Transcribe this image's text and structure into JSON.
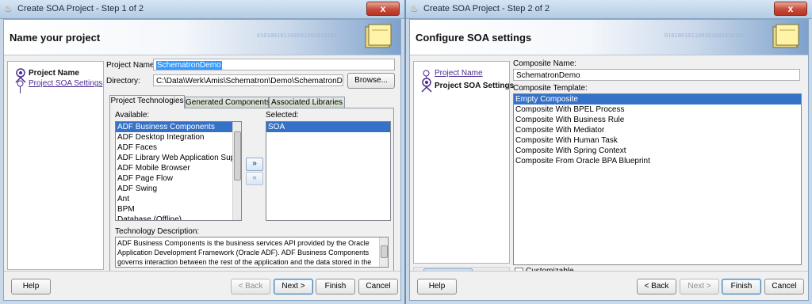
{
  "window1": {
    "title": "Create SOA Project - Step 1 of 2",
    "close_glyph": "x",
    "banner_title": "Name your project",
    "banner_digits": "010100101100101001010101",
    "nav": [
      {
        "label": "Project Name",
        "state": "current"
      },
      {
        "label": "Project SOA Settings",
        "state": "link"
      }
    ],
    "project_name_label": "Project Name:",
    "project_name_value": "SchematronDemo",
    "directory_label": "Directory:",
    "directory_value": "C:\\Data\\Werk\\Amis\\Schematron\\Demo\\SchematronDemo",
    "browse_label": "Browse...",
    "tabs": [
      "Project Technologies",
      "Generated Components",
      "Associated Libraries"
    ],
    "available_label": "Available:",
    "available_items": [
      "ADF Business Components",
      "ADF Desktop Integration",
      "ADF Faces",
      "ADF Library Web Application Support",
      "ADF Mobile Browser",
      "ADF Page Flow",
      "ADF Swing",
      "Ant",
      "BPM",
      "Database (Offline)"
    ],
    "available_selected": 0,
    "selected_label": "Selected:",
    "selected_items": [
      "SOA"
    ],
    "add_arrow": "»",
    "remove_arrow": "«",
    "desc_label": "Technology Description:",
    "desc_text": "ADF Business Components is the business services API provided by the Oracle Application Development Framework (Oracle ADF).  ADF Business Components governs interaction between the rest of the application and the data stored in the",
    "help_label": "Help",
    "back_label": "< Back",
    "next_label": "Next >",
    "finish_label": "Finish",
    "cancel_label": "Cancel"
  },
  "window2": {
    "title": "Create SOA Project - Step 2 of 2",
    "close_glyph": "x",
    "banner_title": "Configure SOA settings",
    "banner_digits": "010100101100101001010101",
    "nav": [
      {
        "label": "Project Name",
        "state": "link"
      },
      {
        "label": "Project SOA Settings",
        "state": "current"
      }
    ],
    "composite_name_label": "Composite Name:",
    "composite_name_value": "SchematronDemo",
    "composite_template_label": "Composite Template:",
    "templates": [
      "Empty Composite",
      "Composite With BPEL Process",
      "Composite With Business Rule",
      "Composite With Mediator",
      "Composite With Human Task",
      "Composite With Spring Context",
      "Composite From Oracle BPA Blueprint"
    ],
    "template_selected": 0,
    "customizable_label": "Customizable",
    "customizable_checked": false,
    "help_label": "Help",
    "back_label": "< Back",
    "next_label": "Next >",
    "finish_label": "Finish",
    "cancel_label": "Cancel"
  }
}
